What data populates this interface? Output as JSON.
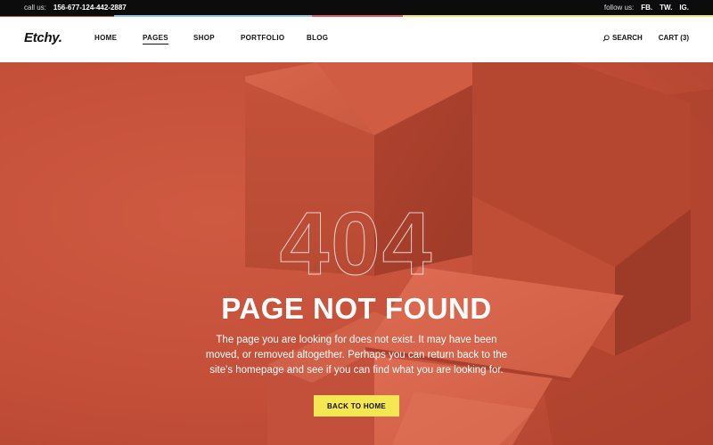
{
  "topbar": {
    "call_label": "call us:",
    "phone": "156-677-124-442-2887",
    "follow_label": "follow us:",
    "social": [
      "FB.",
      "TW.",
      "IG."
    ]
  },
  "nav": {
    "logo": "Etchy.",
    "menu": [
      "HOME",
      "PAGES",
      "SHOP",
      "PORTFOLIO",
      "BLOG"
    ],
    "active_index": 1,
    "search_label": "SEARCH",
    "cart_label": "CART (3)"
  },
  "hero": {
    "code": "404",
    "title": "PAGE NOT FOUND",
    "description": "The page you are looking for does not exist. It may have been moved, or removed altogether. Perhaps you can return back to the site's homepage and see if you can find what you are looking for.",
    "button_label": "BACK TO HOME"
  },
  "colors": {
    "hero_bg": "#c8523c",
    "button_bg": "#f5e653",
    "topbar_bg": "#0c0c0c"
  }
}
